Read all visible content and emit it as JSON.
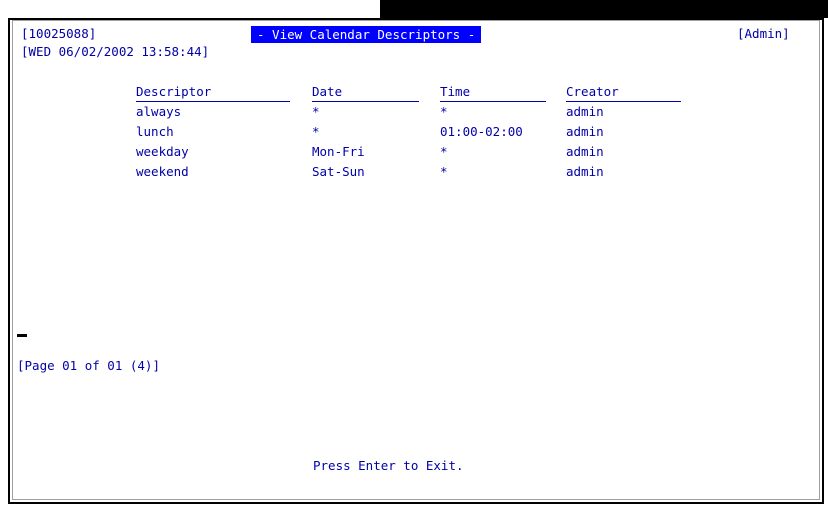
{
  "header": {
    "session_id": "[10025088]",
    "title": "- View Calendar Descriptors -",
    "role": "[Admin]",
    "datetime": "[WED 06/02/2002 13:58:44]"
  },
  "table": {
    "columns": [
      "Descriptor",
      "Date",
      "Time",
      "Creator"
    ],
    "rows": [
      {
        "descriptor": "always",
        "date": "*",
        "time": "*",
        "creator": "admin"
      },
      {
        "descriptor": "lunch",
        "date": "*",
        "time": "01:00-02:00",
        "creator": "admin"
      },
      {
        "descriptor": "weekday",
        "date": "Mon-Fri",
        "time": "*",
        "creator": "admin"
      },
      {
        "descriptor": "weekend",
        "date": "Sat-Sun",
        "time": "*",
        "creator": "admin"
      }
    ]
  },
  "footer": {
    "page_info": "[Page 01 of 01 (4)]",
    "exit_prompt": "Press Enter to Exit."
  }
}
